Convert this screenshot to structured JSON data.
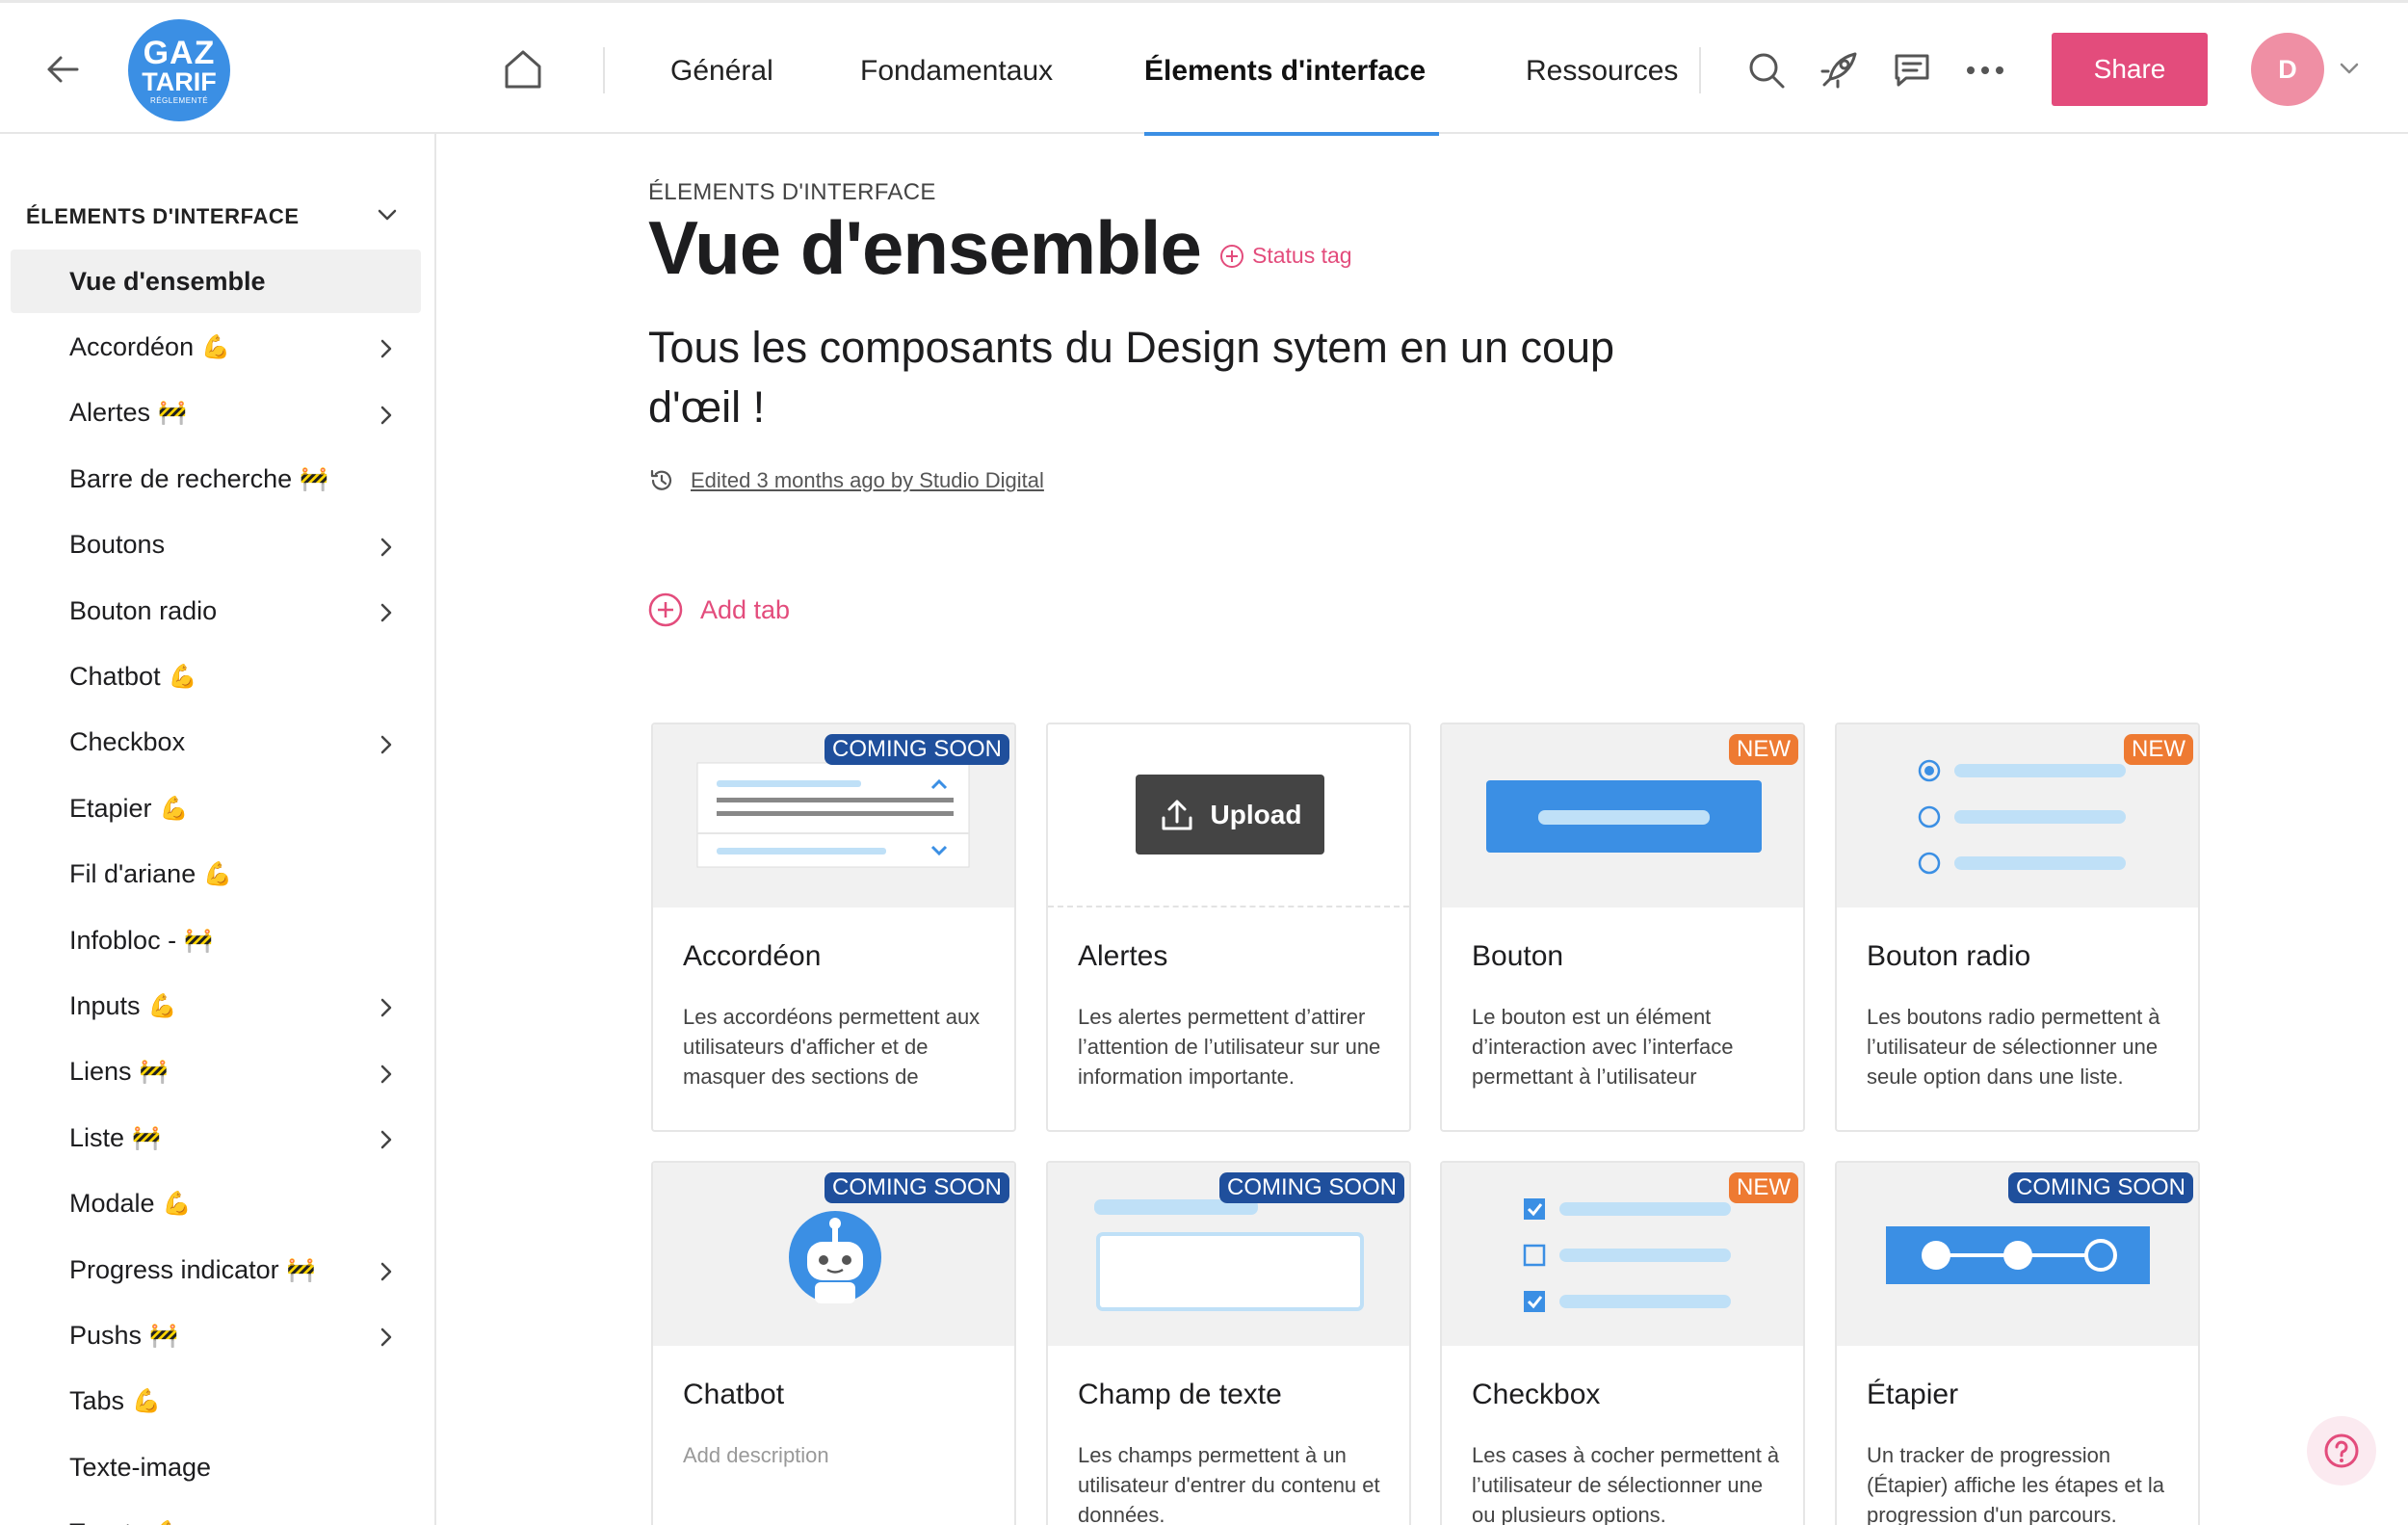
{
  "logo": {
    "line1": "GAZ",
    "line2": "TARIF",
    "line3": "RÉGLEMENTÉ"
  },
  "nav": {
    "tabs": [
      {
        "label": "Général"
      },
      {
        "label": "Fondamentaux"
      },
      {
        "label": "Élements d'interface",
        "active": true
      },
      {
        "label": "Ressources"
      }
    ],
    "share_label": "Share",
    "avatar_initial": "D"
  },
  "sidebar": {
    "heading": "ÉLEMENTS D'INTERFACE",
    "items": [
      {
        "label": "Vue d'ensemble",
        "emoji": "",
        "chevron": false,
        "active": true
      },
      {
        "label": "Accordéon",
        "emoji": "💪",
        "chevron": true
      },
      {
        "label": "Alertes",
        "emoji": "🚧",
        "chevron": true
      },
      {
        "label": "Barre de recherche",
        "emoji": "🚧",
        "chevron": false
      },
      {
        "label": "Boutons",
        "emoji": "",
        "chevron": true
      },
      {
        "label": "Bouton radio",
        "emoji": "",
        "chevron": true
      },
      {
        "label": "Chatbot",
        "emoji": "💪",
        "chevron": false
      },
      {
        "label": "Checkbox",
        "emoji": "",
        "chevron": true
      },
      {
        "label": "Etapier",
        "emoji": "💪",
        "chevron": false
      },
      {
        "label": "Fil d'ariane",
        "emoji": "💪",
        "chevron": false
      },
      {
        "label": "Infobloc -",
        "emoji": "🚧",
        "chevron": false
      },
      {
        "label": "Inputs",
        "emoji": "💪",
        "chevron": true
      },
      {
        "label": "Liens",
        "emoji": "🚧",
        "chevron": true
      },
      {
        "label": "Liste",
        "emoji": "🚧",
        "chevron": true
      },
      {
        "label": "Modale",
        "emoji": "💪",
        "chevron": false
      },
      {
        "label": "Progress indicator",
        "emoji": "🚧",
        "chevron": true
      },
      {
        "label": "Pushs",
        "emoji": "🚧",
        "chevron": true
      },
      {
        "label": "Tabs",
        "emoji": "💪",
        "chevron": false
      },
      {
        "label": "Texte-image",
        "emoji": "",
        "chevron": false
      },
      {
        "label": "Toasts",
        "emoji": "💪",
        "chevron": false
      }
    ]
  },
  "main": {
    "eyebrow": "ÉLEMENTS D'INTERFACE",
    "title": "Vue d'ensemble",
    "status_tag": "Status tag",
    "subtitle": "Tous les composants du Design sytem en un coup d'œil !",
    "edited": "Edited 3 months ago by Studio Digital",
    "add_tab": "Add tab"
  },
  "cards": [
    {
      "title": "Accordéon",
      "badge": "COMING SOON",
      "badge_type": "cs",
      "thumb": "accordion",
      "description": "Les accordéons permettent aux utilisateurs d'afficher et de masquer des sections de contenu présentées dans une page."
    },
    {
      "title": "Alertes",
      "badge": "",
      "badge_type": "",
      "thumb": "upload",
      "upload_label": "Upload",
      "description": "Les alertes permettent d’attirer l’attention de l’utilisateur sur une information importante."
    },
    {
      "title": "Bouton",
      "badge": "NEW",
      "badge_type": "new",
      "thumb": "button",
      "description": "Le bouton est un élément d’interaction avec l’interface permettant à l’utilisateur d’effectuer une action."
    },
    {
      "title": "Bouton radio",
      "badge": "NEW",
      "badge_type": "new",
      "thumb": "radio",
      "description": "Les boutons radio permettent à l’utilisateur de sélectionner une seule option dans une liste."
    },
    {
      "title": "Chatbot",
      "badge": "COMING SOON",
      "badge_type": "cs",
      "thumb": "chatbot",
      "description": "Add description",
      "muted": true
    },
    {
      "title": "Champ de texte",
      "badge": "COMING SOON",
      "badge_type": "cs",
      "thumb": "textfield",
      "description": "Les champs permettent à un utilisateur d'entrer du contenu et données."
    },
    {
      "title": "Checkbox",
      "badge": "NEW",
      "badge_type": "new",
      "thumb": "checkbox",
      "description": "Les cases à cocher permettent à l’utilisateur de sélectionner une ou plusieurs options."
    },
    {
      "title": "Étapier",
      "badge": "COMING SOON",
      "badge_type": "cs",
      "thumb": "stepper",
      "description": "Un tracker de progression (Étapier) affiche les étapes et la progression d'un parcours."
    }
  ],
  "colors": {
    "accent": "#e34c7c",
    "primary": "#3b8fe4",
    "badge_coming_soon": "#1f4f9c",
    "badge_new": "#ee7a32"
  }
}
